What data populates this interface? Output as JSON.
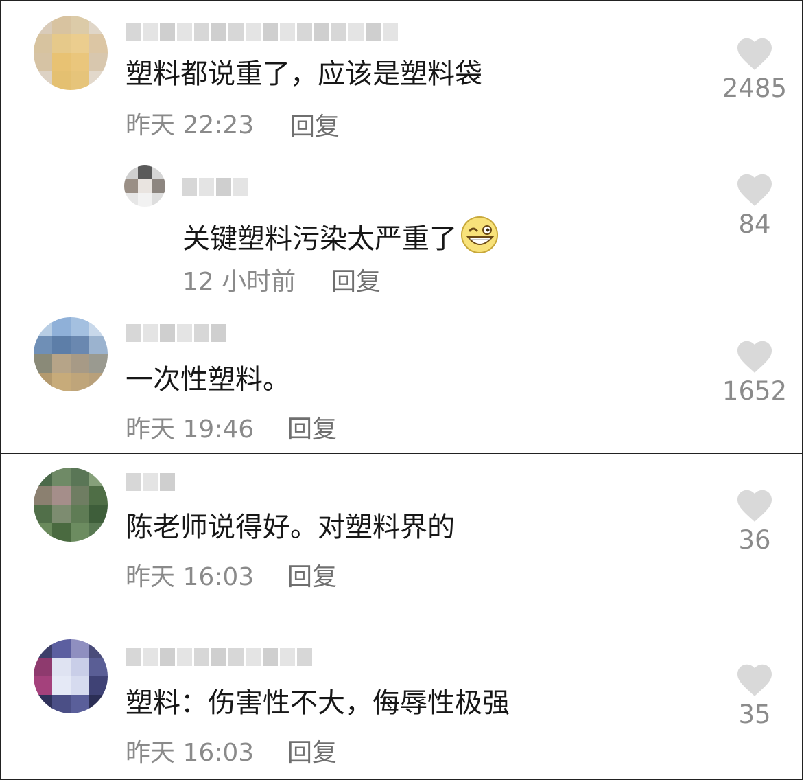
{
  "comments": [
    {
      "text": "塑料都说重了，应该是塑料袋",
      "time": "昨天 22:23",
      "reply_label": "回复",
      "likes": "2485",
      "replies": [
        {
          "text": "关键塑料污染太严重了",
          "time": "12 小时前",
          "reply_label": "回复",
          "likes": "84",
          "emoji_icon": "grinning-wink-emoji"
        }
      ]
    },
    {
      "text": "一次性塑料。",
      "time": "昨天 19:46",
      "reply_label": "回复",
      "likes": "1652"
    },
    {
      "text": "陈老师说得好。对塑料界的",
      "time": "昨天 16:03",
      "reply_label": "回复",
      "likes": "36"
    },
    {
      "text": "塑料：伤害性不大，侮辱性极强",
      "time": "昨天 16:03",
      "reply_label": "回复",
      "likes": "35"
    }
  ],
  "icons": {
    "like": "heart-icon",
    "avatar": "avatar"
  },
  "colors": {
    "heart": "#d9d9d9",
    "meta_text": "#8a8a8a",
    "border": "#222222"
  }
}
